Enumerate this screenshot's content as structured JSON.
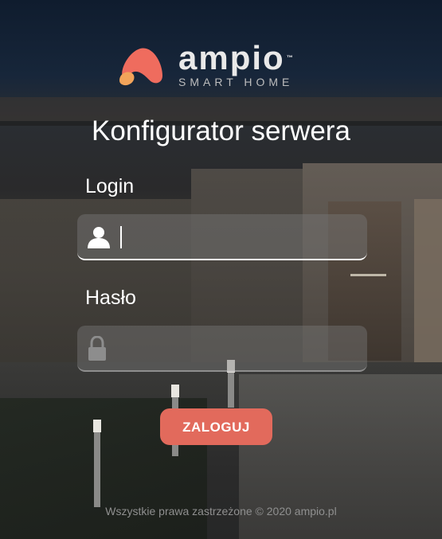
{
  "brand": {
    "name": "ampio",
    "trademark": "™",
    "tagline": "SMART HOME",
    "colors": {
      "mark_top": "#ef6c5e",
      "mark_bottom": "#f2a45a",
      "accent": "#e26a5c"
    }
  },
  "page_title": "Konfigurator serwera",
  "login": {
    "label": "Login",
    "value": "",
    "icon": "user-icon"
  },
  "password": {
    "label": "Hasło",
    "value": "",
    "icon": "lock-icon"
  },
  "submit_label": "ZALOGUJ",
  "footer": "Wszystkie prawa zastrzeżone © 2020 ampio.pl"
}
